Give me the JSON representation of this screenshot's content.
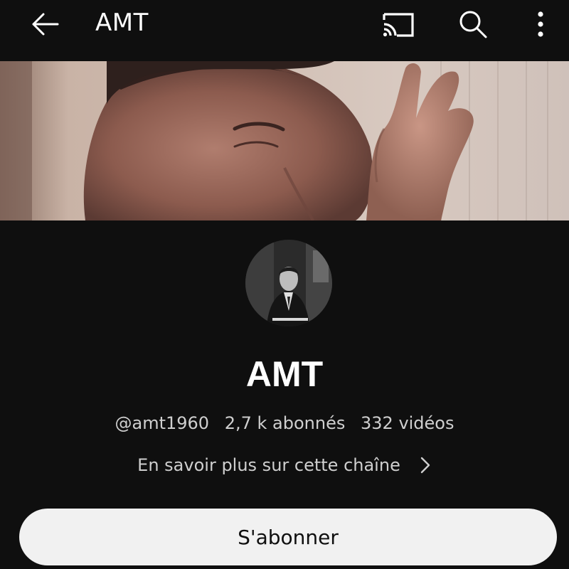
{
  "header": {
    "title": "AMT",
    "back_icon": "arrow-left-icon",
    "cast_icon": "cast-icon",
    "search_icon": "search-icon",
    "more_icon": "more-vertical-icon"
  },
  "channel": {
    "name": "AMT",
    "handle": "@amt1960",
    "subscribers": "2,7 k abonnés",
    "videos": "332 vidéos",
    "about_link": "En savoir plus sur cette chaîne"
  },
  "actions": {
    "subscribe_label": "S'abonner"
  },
  "colors": {
    "background": "#0f0f0f",
    "text_primary": "#ffffff",
    "text_secondary": "#cfcfcf",
    "button_bg": "#f1f1f1",
    "button_text": "#0f0f0f"
  }
}
